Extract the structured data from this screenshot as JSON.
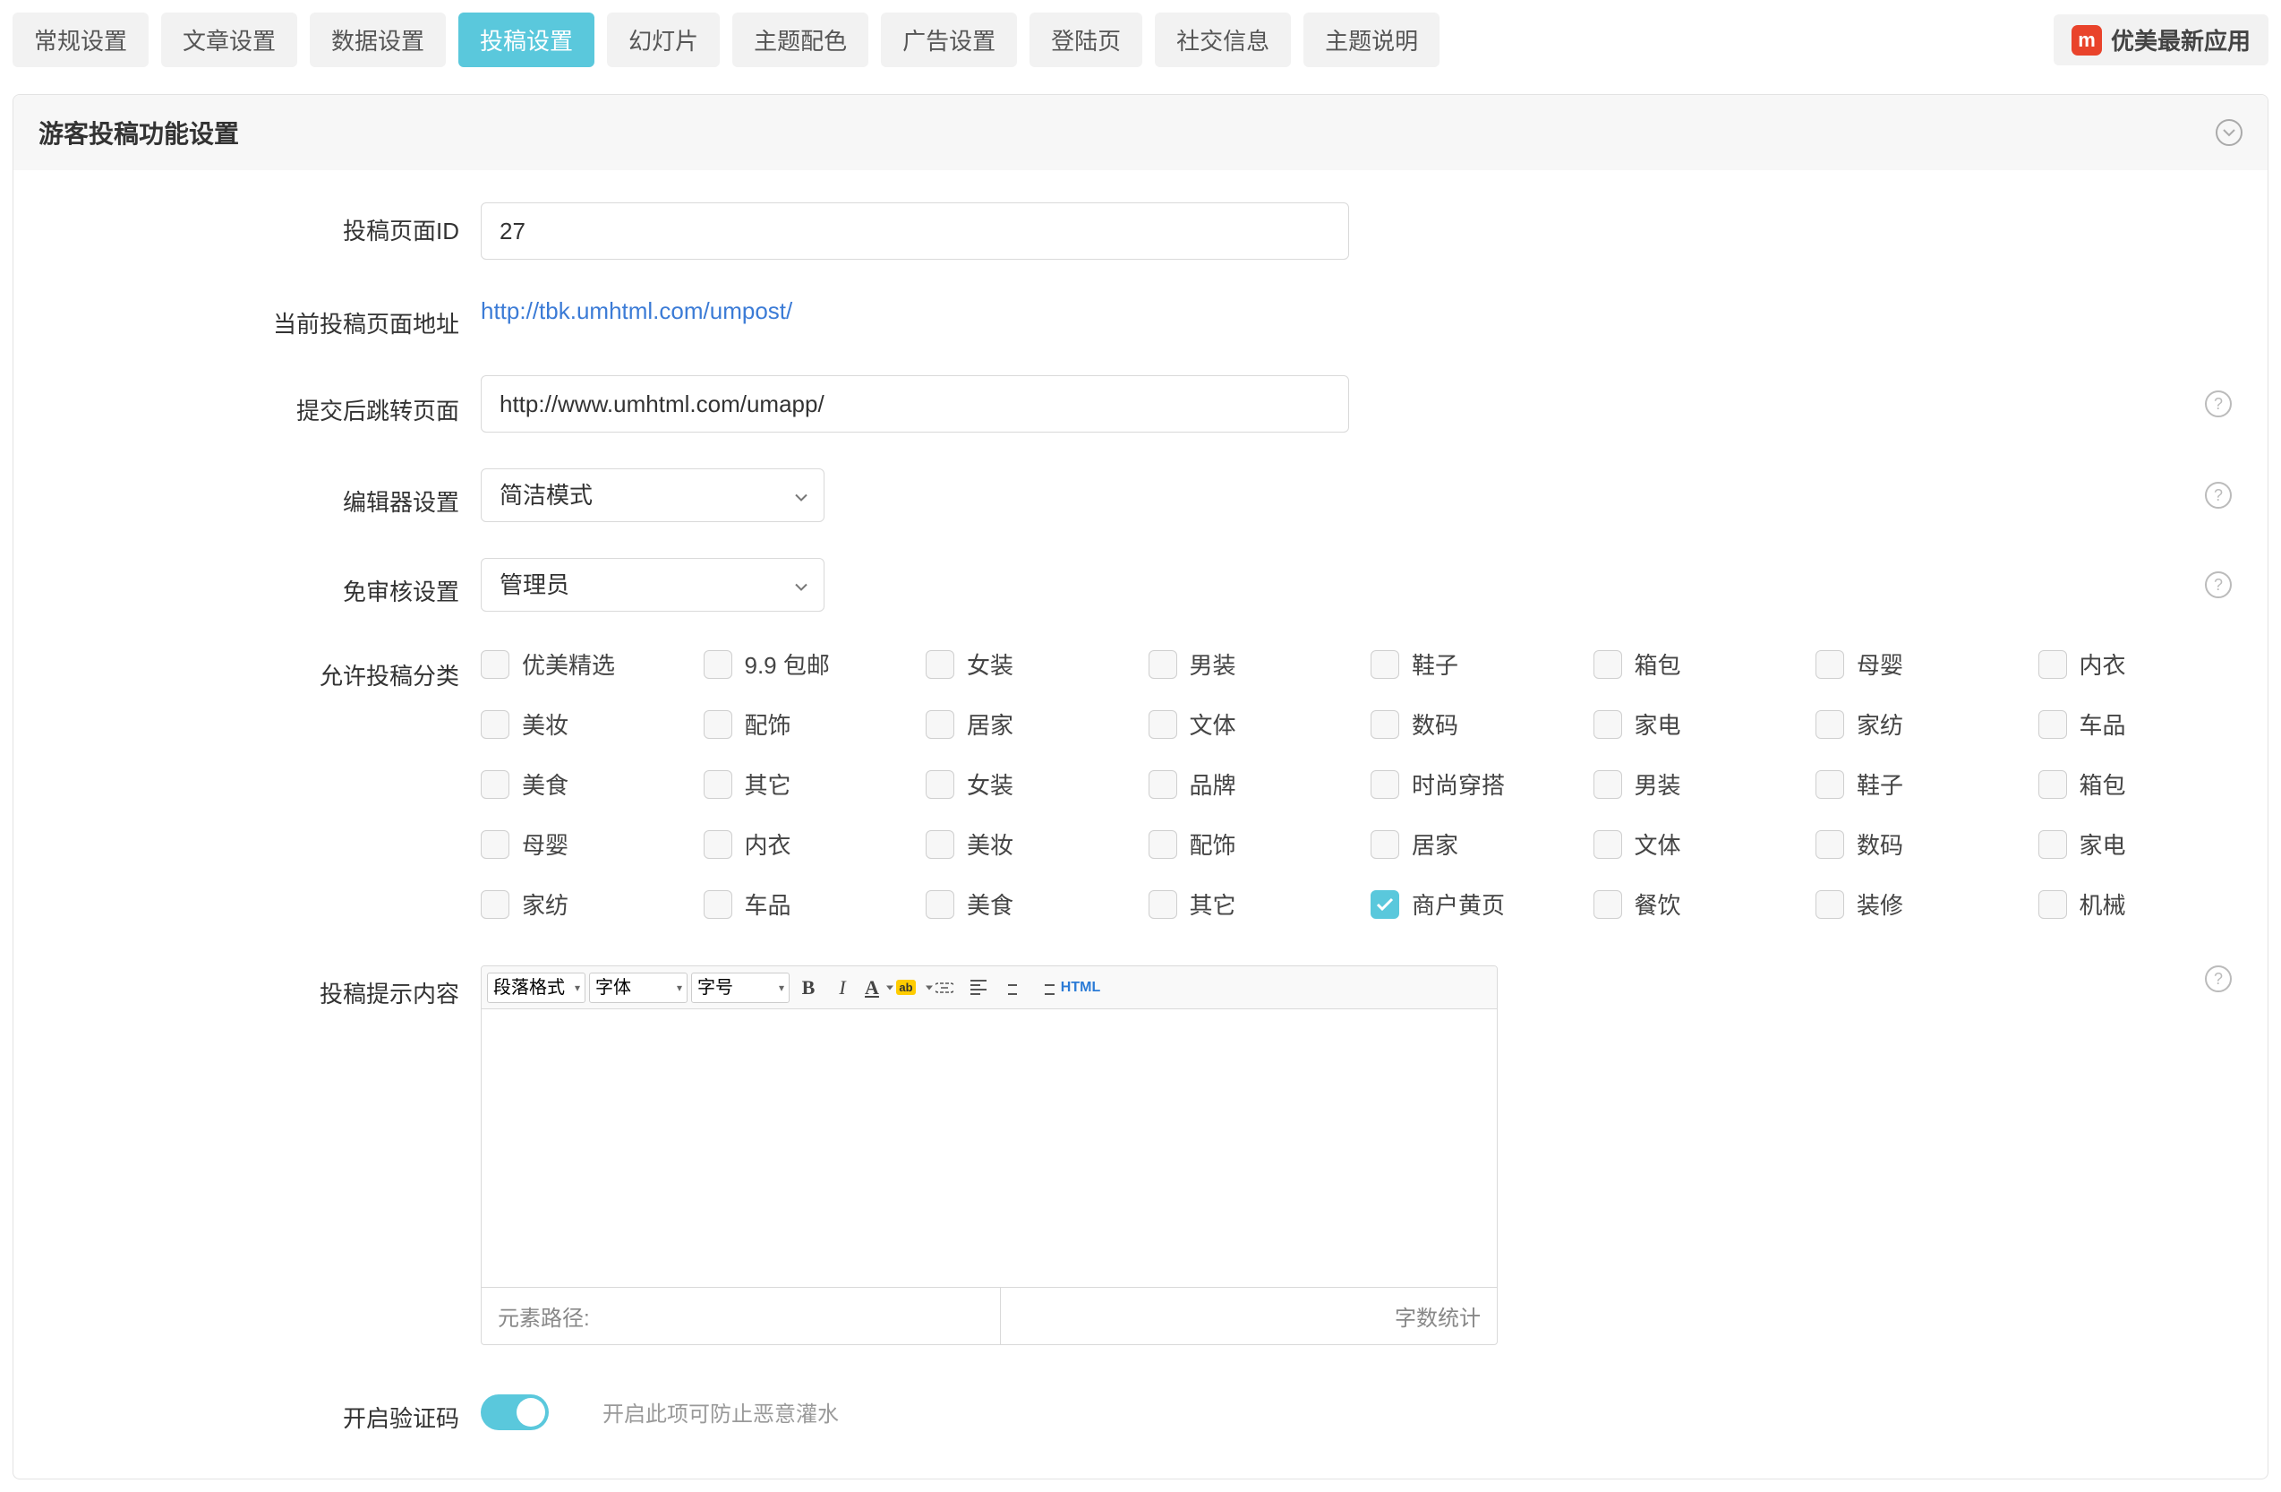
{
  "tabs": [
    "常规设置",
    "文章设置",
    "数据设置",
    "投稿设置",
    "幻灯片",
    "主题配色",
    "广告设置",
    "登陆页",
    "社交信息",
    "主题说明"
  ],
  "active_tab_index": 3,
  "promo": {
    "label": "优美最新应用",
    "icon_text": "m"
  },
  "panel": {
    "title": "游客投稿功能设置",
    "fields": {
      "page_id": {
        "label": "投稿页面ID",
        "value": "27"
      },
      "current_url": {
        "label": "当前投稿页面地址",
        "value": "http://tbk.umhtml.com/umpost/"
      },
      "redirect_url": {
        "label": "提交后跳转页面",
        "value": "http://www.umhtml.com/umapp/"
      },
      "editor_mode": {
        "label": "编辑器设置",
        "value": "简洁模式"
      },
      "no_review": {
        "label": "免审核设置",
        "value": "管理员"
      },
      "categories_label": "允许投稿分类",
      "prompt_content_label": "投稿提示内容",
      "captcha": {
        "label": "开启验证码",
        "hint": "开启此项可防止恶意灌水",
        "on": true
      }
    },
    "categories": [
      {
        "label": "优美精选",
        "checked": false
      },
      {
        "label": "9.9 包邮",
        "checked": false
      },
      {
        "label": "女装",
        "checked": false
      },
      {
        "label": "男装",
        "checked": false
      },
      {
        "label": "鞋子",
        "checked": false
      },
      {
        "label": "箱包",
        "checked": false
      },
      {
        "label": "母婴",
        "checked": false
      },
      {
        "label": "内衣",
        "checked": false
      },
      {
        "label": "美妆",
        "checked": false
      },
      {
        "label": "配饰",
        "checked": false
      },
      {
        "label": "居家",
        "checked": false
      },
      {
        "label": "文体",
        "checked": false
      },
      {
        "label": "数码",
        "checked": false
      },
      {
        "label": "家电",
        "checked": false
      },
      {
        "label": "家纺",
        "checked": false
      },
      {
        "label": "车品",
        "checked": false
      },
      {
        "label": "美食",
        "checked": false
      },
      {
        "label": "其它",
        "checked": false
      },
      {
        "label": "女装",
        "checked": false
      },
      {
        "label": "品牌",
        "checked": false
      },
      {
        "label": "时尚穿搭",
        "checked": false
      },
      {
        "label": "男装",
        "checked": false
      },
      {
        "label": "鞋子",
        "checked": false
      },
      {
        "label": "箱包",
        "checked": false
      },
      {
        "label": "母婴",
        "checked": false
      },
      {
        "label": "内衣",
        "checked": false
      },
      {
        "label": "美妆",
        "checked": false
      },
      {
        "label": "配饰",
        "checked": false
      },
      {
        "label": "居家",
        "checked": false
      },
      {
        "label": "文体",
        "checked": false
      },
      {
        "label": "数码",
        "checked": false
      },
      {
        "label": "家电",
        "checked": false
      },
      {
        "label": "家纺",
        "checked": false
      },
      {
        "label": "车品",
        "checked": false
      },
      {
        "label": "美食",
        "checked": false
      },
      {
        "label": "其它",
        "checked": false
      },
      {
        "label": "商户黄页",
        "checked": true
      },
      {
        "label": "餐饮",
        "checked": false
      },
      {
        "label": "装修",
        "checked": false
      },
      {
        "label": "机械",
        "checked": false
      }
    ],
    "editor_toolbar": {
      "format": "段落格式",
      "font": "字体",
      "size": "字号",
      "html": "HTML"
    },
    "editor_footer": {
      "path_label": "元素路径:",
      "word_count_label": "字数统计"
    }
  }
}
